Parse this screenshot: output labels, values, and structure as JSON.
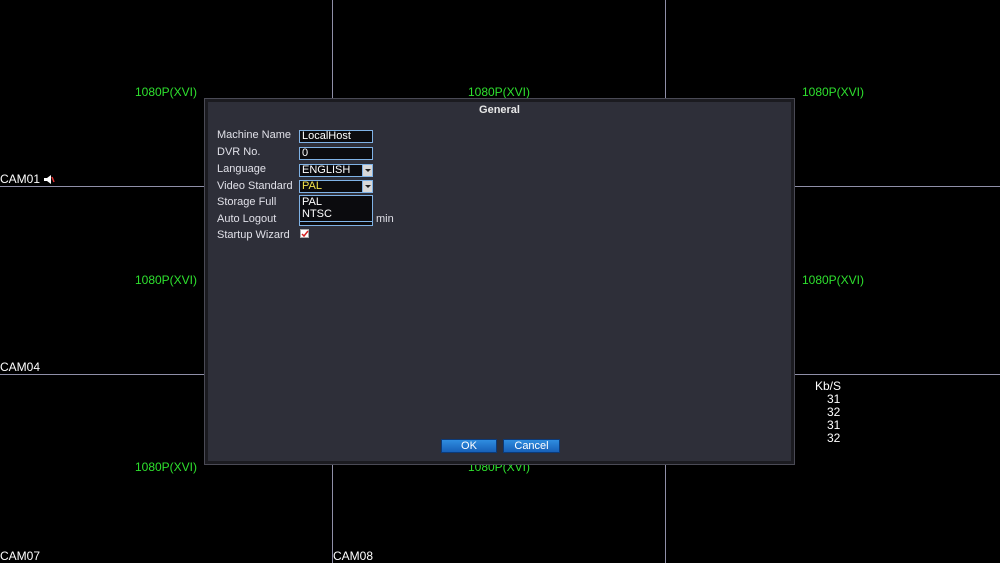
{
  "cameras": [
    {
      "name": "CAM01",
      "resolution": "1080P(XVI)",
      "audio_icon": "speaker-icon"
    },
    {
      "name": "",
      "resolution": "1080P(XVI)"
    },
    {
      "name": "",
      "resolution": "1080P(XVI)"
    },
    {
      "name": "CAM04",
      "resolution": "1080P(XVI)"
    },
    {
      "name": "",
      "resolution": ""
    },
    {
      "name": "",
      "resolution": "1080P(XVI)"
    },
    {
      "name": "CAM07",
      "resolution": "1080P(XVI)"
    },
    {
      "name": "CAM08",
      "resolution": "1080P(XVI)"
    },
    {
      "name": "",
      "resolution": ""
    }
  ],
  "bitrate": {
    "header": "Kb/S",
    "values": [
      "31",
      "32",
      "31",
      "32"
    ]
  },
  "dialog": {
    "title": "General",
    "labels": {
      "machine_name": "Machine Name",
      "dvr_no": "DVR No.",
      "language": "Language",
      "video_standard": "Video Standard",
      "storage_full": "Storage Full",
      "auto_logout": "Auto Logout",
      "startup_wizard": "Startup Wizard"
    },
    "values": {
      "machine_name": "LocalHost",
      "dvr_no": "0",
      "language": "ENGLISH",
      "video_standard": "PAL",
      "auto_logout_unit": "min",
      "startup_wizard_checked": true
    },
    "video_standard_options": [
      "PAL",
      "NTSC"
    ],
    "buttons": {
      "ok": "OK",
      "cancel": "Cancel"
    }
  },
  "colors": {
    "resolution_text": "#2ee02e",
    "dialog_bg": "#2e2f39",
    "field_border": "#7fb2e5",
    "button_blue": "#1f74cc",
    "selected_option_text": "#f2e34a"
  }
}
